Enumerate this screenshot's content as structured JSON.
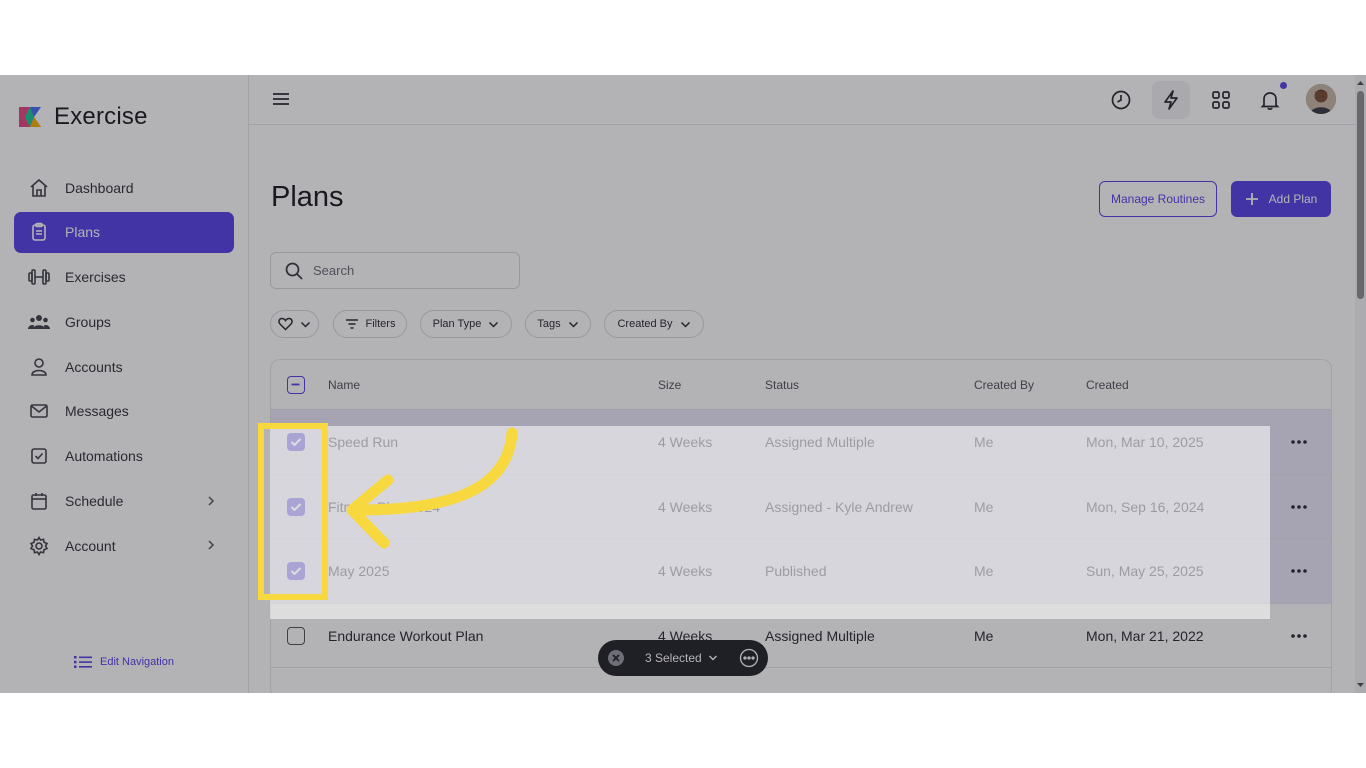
{
  "app": {
    "name": "Exercise"
  },
  "sidebar": {
    "items": [
      {
        "label": "Dashboard",
        "icon": "home-icon"
      },
      {
        "label": "Plans",
        "icon": "clipboard-icon",
        "active": true
      },
      {
        "label": "Exercises",
        "icon": "dumbbell-icon"
      },
      {
        "label": "Groups",
        "icon": "users-icon"
      },
      {
        "label": "Accounts",
        "icon": "user-icon"
      },
      {
        "label": "Messages",
        "icon": "mail-icon"
      },
      {
        "label": "Automations",
        "icon": "check-square-icon"
      },
      {
        "label": "Schedule",
        "icon": "calendar-icon",
        "has_submenu": true
      },
      {
        "label": "Account",
        "icon": "gear-icon",
        "has_submenu": true
      }
    ],
    "edit_navigation_label": "Edit Navigation"
  },
  "page": {
    "title": "Plans",
    "manage_routines_label": "Manage Routines",
    "add_plan_label": "Add Plan"
  },
  "search": {
    "placeholder": "Search"
  },
  "filters": {
    "favorite_icon": "heart-icon",
    "filters_label": "Filters",
    "plan_type_label": "Plan Type",
    "tags_label": "Tags",
    "created_by_label": "Created By"
  },
  "table": {
    "columns": {
      "name": "Name",
      "size": "Size",
      "status": "Status",
      "created_by": "Created By",
      "created": "Created"
    },
    "rows": [
      {
        "name": "Speed Run",
        "size": "4 Weeks",
        "status": "Assigned Multiple",
        "created_by": "Me",
        "created": "Mon, Mar 10, 2025",
        "selected": true
      },
      {
        "name": "Fitness Plan 2024",
        "size": "4 Weeks",
        "status": "Assigned - Kyle Andrew",
        "created_by": "Me",
        "created": "Mon, Sep 16, 2024",
        "selected": true
      },
      {
        "name": "May 2025",
        "size": "4 Weeks",
        "status": "Published",
        "created_by": "Me",
        "created": "Sun, May 25, 2025",
        "selected": true
      },
      {
        "name": "Endurance Workout Plan",
        "size": "4 Weeks",
        "status": "Assigned Multiple",
        "created_by": "Me",
        "created": "Mon, Mar 21, 2022",
        "selected": false
      }
    ]
  },
  "selection": {
    "label": "3 Selected"
  },
  "colors": {
    "accent": "#5b45e6",
    "highlight": "#f7d93f",
    "dark_pill": "#26262c"
  }
}
